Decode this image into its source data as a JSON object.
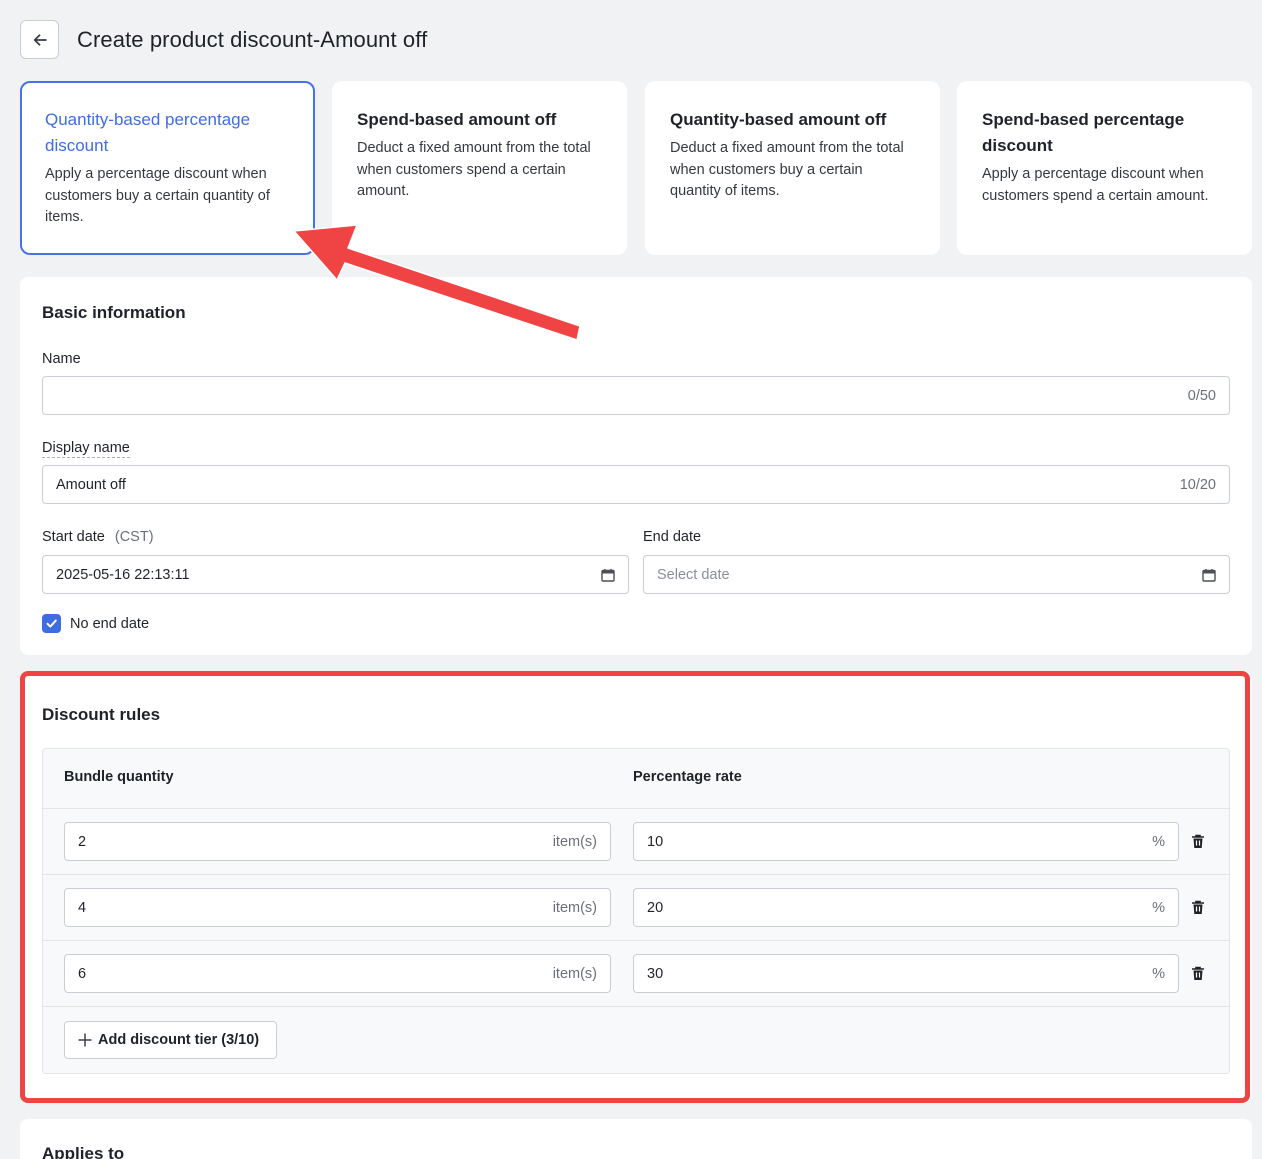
{
  "header": {
    "title": "Create product discount-Amount off"
  },
  "type_cards": [
    {
      "title": "Quantity-based percentage discount",
      "desc": "Apply a percentage discount when customers buy a certain quantity of items."
    },
    {
      "title": "Spend-based amount off",
      "desc": "Deduct a fixed amount from the total when customers spend a certain amount."
    },
    {
      "title": "Quantity-based amount off",
      "desc": "Deduct a fixed amount from the total when customers buy a certain quantity of items."
    },
    {
      "title": "Spend-based percentage discount",
      "desc": "Apply a percentage discount when customers spend a certain amount."
    }
  ],
  "basic": {
    "title": "Basic information",
    "name_label": "Name",
    "name_value": "",
    "name_counter": "0/50",
    "display_label": "Display name",
    "display_value": "Amount off",
    "display_counter": "10/20",
    "start_label": "Start date",
    "start_tz": "(CST)",
    "start_value": "2025-05-16 22:13:11",
    "end_label": "End date",
    "end_placeholder": "Select date",
    "no_end_label": "No end date",
    "no_end_checked": true
  },
  "rules": {
    "title": "Discount rules",
    "col_quantity": "Bundle quantity",
    "col_rate": "Percentage rate",
    "quantity_suffix": "item(s)",
    "rate_suffix": "%",
    "rows": [
      {
        "quantity": "2",
        "rate": "10"
      },
      {
        "quantity": "4",
        "rate": "20"
      },
      {
        "quantity": "6",
        "rate": "30"
      }
    ],
    "add_label": "Add discount tier (3/10)"
  },
  "applies": {
    "title": "Applies to"
  },
  "colors": {
    "accent": "#3f6ce0",
    "highlight": "#ef4444",
    "arrow": "#f04444"
  }
}
